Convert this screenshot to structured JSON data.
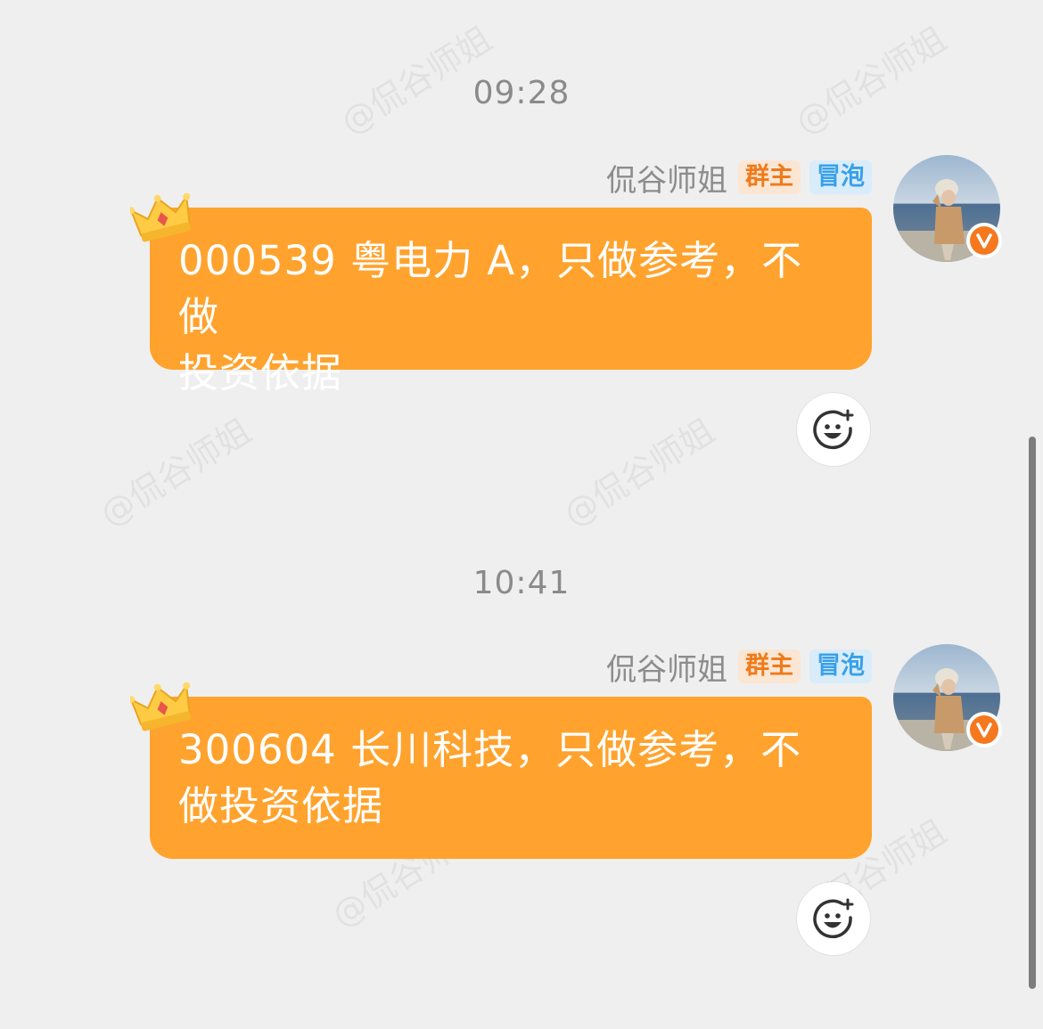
{
  "watermark_text": "@侃谷师姐",
  "messages": [
    {
      "time": "09:28",
      "sender": "侃谷师姐",
      "badge_owner": "群主",
      "badge_bubble": "冒泡",
      "text_line1": "000539 粤电力 A，只做参考，不做",
      "text_line2": "投资依据"
    },
    {
      "time": "10:41",
      "sender": "侃谷师姐",
      "badge_owner": "群主",
      "badge_bubble": "冒泡",
      "text_line1": "300604 长川科技，只做参考，不",
      "text_line2": "做投资依据"
    }
  ],
  "icons": {
    "crown": "crown-icon",
    "verified": "verified-v-icon",
    "reaction": "add-reaction-icon"
  },
  "colors": {
    "bubble": "#ffa32e",
    "owner_badge_text": "#f07a1a",
    "bubble_badge_text": "#38a0e8",
    "verified": "#f5781e"
  }
}
